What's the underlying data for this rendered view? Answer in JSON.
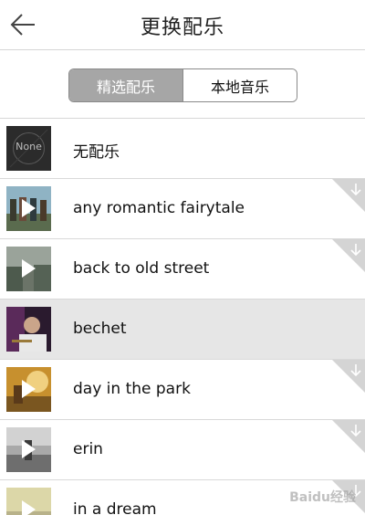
{
  "header": {
    "title": "更换配乐",
    "back_icon": "arrow-left-icon"
  },
  "tabs": [
    {
      "label": "精选配乐",
      "active": true
    },
    {
      "label": "本地音乐",
      "active": false
    }
  ],
  "list": [
    {
      "label": "无配乐",
      "thumb_text": "None",
      "downloadable": false,
      "selected": false
    },
    {
      "label": "any romantic fairytale",
      "downloadable": true,
      "selected": false
    },
    {
      "label": "back to old street",
      "downloadable": true,
      "selected": false
    },
    {
      "label": "bechet",
      "downloadable": false,
      "selected": true
    },
    {
      "label": "day in the park",
      "downloadable": true,
      "selected": false
    },
    {
      "label": "erin",
      "downloadable": true,
      "selected": false
    },
    {
      "label": "in a dream",
      "downloadable": true,
      "selected": false
    }
  ],
  "watermark": "Baidu经验",
  "colors": {
    "tab_active_bg": "#a6a6a6",
    "selected_row_bg": "#e6e6e6",
    "divider": "#d9d9d9"
  }
}
